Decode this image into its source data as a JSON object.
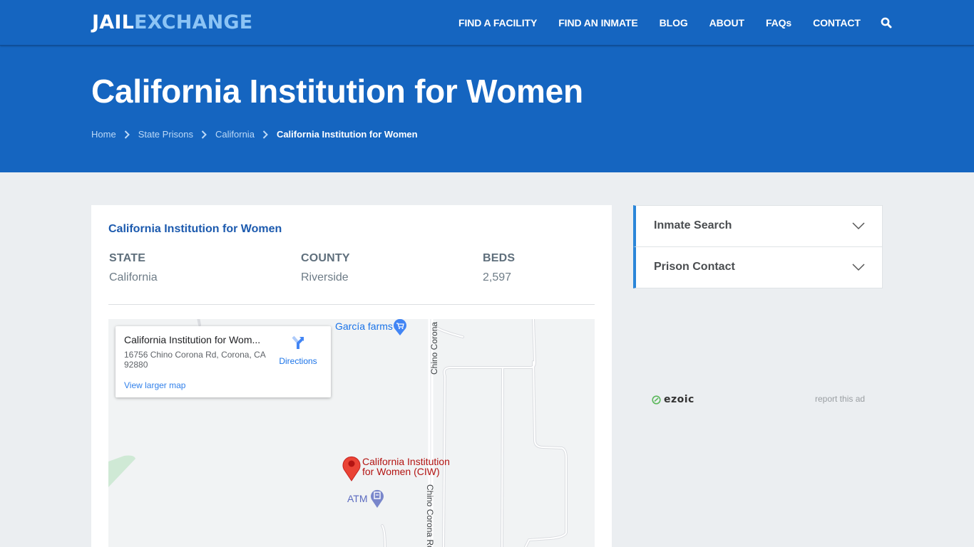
{
  "header": {
    "logo_part1": "JAIL",
    "logo_part2": "EXCHANGE",
    "nav": [
      {
        "label": "FIND A FACILITY"
      },
      {
        "label": "FIND AN INMATE"
      },
      {
        "label": "BLOG"
      },
      {
        "label": "ABOUT"
      },
      {
        "label": "FAQs"
      },
      {
        "label": "CONTACT"
      }
    ],
    "search_icon": "search-icon"
  },
  "hero": {
    "title": "California Institution for Women",
    "breadcrumb": [
      {
        "label": "Home"
      },
      {
        "label": "State Prisons"
      },
      {
        "label": "California"
      },
      {
        "label": "California Institution for Women"
      }
    ]
  },
  "facility": {
    "title": "California Institution for Women",
    "facts": [
      {
        "label": "STATE",
        "value": "California"
      },
      {
        "label": "COUNTY",
        "value": "Riverside"
      },
      {
        "label": "BEDS",
        "value": "2,597"
      }
    ]
  },
  "map": {
    "info_name": "California Institution for Wom...",
    "info_address": "16756 Chino Corona Rd, Corona, CA 92880",
    "directions_label": "Directions",
    "view_larger": "View larger map",
    "poi_farm": "García farms",
    "poi_main_line1": "California Institution",
    "poi_main_line2": "for Women (CIW)",
    "poi_atm": "ATM",
    "road_label_top": "Chino Corona I",
    "road_label_bottom": "Chino Corona Rd"
  },
  "sidebar": {
    "accordions": [
      {
        "label": "Inmate Search"
      },
      {
        "label": "Prison Contact"
      }
    ],
    "ad_brand": "ezoic",
    "ad_report": "report this ad"
  },
  "colors": {
    "brand_blue": "#1565c0",
    "logo_light": "#8cc4f5",
    "accent_border": "#2b86d9",
    "title_blue": "#1c5aae"
  }
}
